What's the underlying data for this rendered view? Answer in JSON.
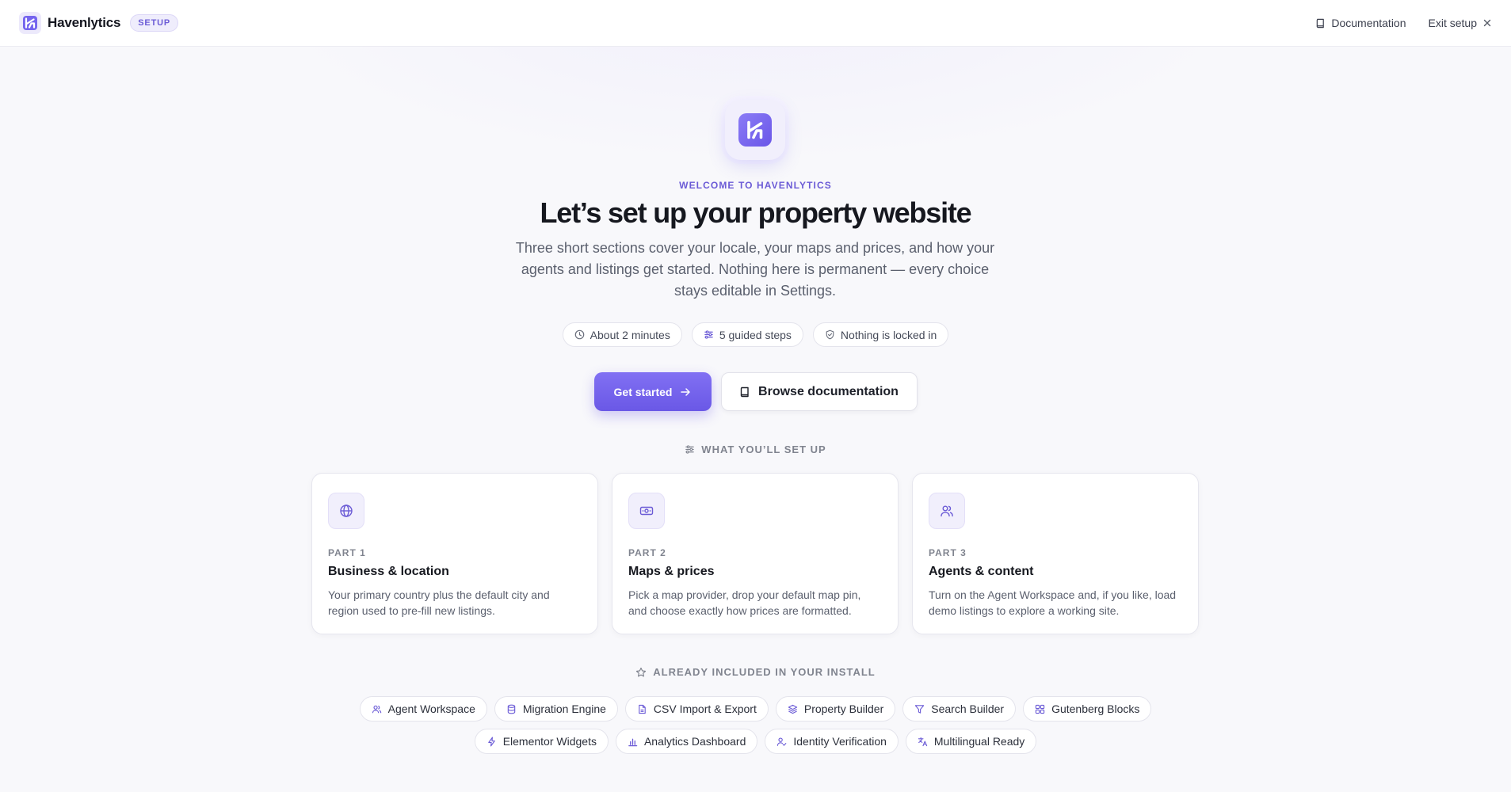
{
  "header": {
    "brand_name": "Havenlytics",
    "badge": "SETUP",
    "nav": [
      {
        "label": "Documentation",
        "icon": "book-icon"
      },
      {
        "label": "Exit setup",
        "icon": "close-icon"
      }
    ]
  },
  "hero": {
    "eyebrow": "WELCOME TO HAVENLYTICS",
    "title": "Let’s set up your property website",
    "subtitle": "Three short sections cover your locale, your maps and prices, and how your agents and listings get started. Nothing here is permanent — every choice stays editable in Settings.",
    "chips": [
      {
        "label": "About 2 minutes",
        "icon": "clock-icon"
      },
      {
        "label": "5 guided steps",
        "icon": "sliders-icon"
      },
      {
        "label": "Nothing is locked in",
        "icon": "shield-check-icon"
      }
    ],
    "primary_cta": "Get started",
    "secondary_cta": "Browse documentation"
  },
  "setup_section": {
    "label": "WHAT YOU’LL SET UP",
    "cards": [
      {
        "part": "PART 1",
        "title": "Business & location",
        "description": "Your primary country plus the default city and region used to pre-fill new listings.",
        "icon": "globe-icon"
      },
      {
        "part": "PART 2",
        "title": "Maps & prices",
        "description": "Pick a map provider, drop your default map pin, and choose exactly how prices are formatted.",
        "icon": "banknote-icon"
      },
      {
        "part": "PART 3",
        "title": "Agents & content",
        "description": "Turn on the Agent Workspace and, if you like, load demo listings to explore a working site.",
        "icon": "users-icon"
      }
    ]
  },
  "included_section": {
    "label": "ALREADY INCLUDED IN YOUR INSTALL",
    "features": [
      {
        "label": "Agent Workspace",
        "icon": "users-icon"
      },
      {
        "label": "Migration Engine",
        "icon": "database-icon"
      },
      {
        "label": "CSV Import & Export",
        "icon": "file-icon"
      },
      {
        "label": "Property Builder",
        "icon": "layers-icon"
      },
      {
        "label": "Search Builder",
        "icon": "filter-icon"
      },
      {
        "label": "Gutenberg Blocks",
        "icon": "grid-icon"
      },
      {
        "label": "Elementor Widgets",
        "icon": "bolt-icon"
      },
      {
        "label": "Analytics Dashboard",
        "icon": "bar-chart-icon"
      },
      {
        "label": "Identity Verification",
        "icon": "user-check-icon"
      },
      {
        "label": "Multilingual Ready",
        "icon": "translate-icon"
      }
    ]
  },
  "colors": {
    "accent": "#6b5bd6",
    "accent_gradient_start": "#8170f3",
    "accent_gradient_end": "#6a58e6"
  }
}
